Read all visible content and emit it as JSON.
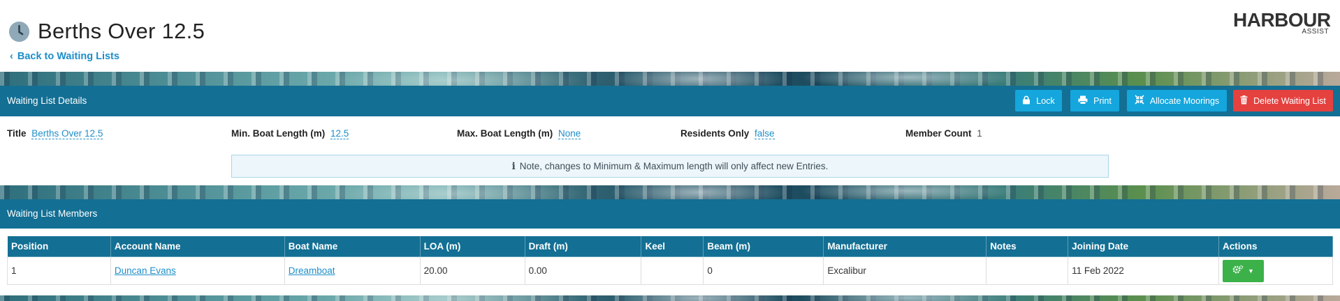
{
  "header": {
    "title": "Berths Over 12.5",
    "back_label": "Back to Waiting Lists",
    "logo_main": "HARBOUR",
    "logo_sub": "ASSIST"
  },
  "details_bar": {
    "title": "Waiting List Details",
    "buttons": {
      "lock": "Lock",
      "print": "Print",
      "allocate": "Allocate Moorings",
      "delete": "Delete Waiting List"
    }
  },
  "details": {
    "title_label": "Title",
    "title_value": "Berths Over 12.5",
    "min_label": "Min. Boat Length (m)",
    "min_value": "12.5",
    "max_label": "Max. Boat Length (m)",
    "max_value": "None",
    "residents_label": "Residents Only",
    "residents_value": "false",
    "count_label": "Member Count",
    "count_value": "1",
    "note": "Note, changes to Minimum & Maximum length will only affect new Entries."
  },
  "members_bar": {
    "title": "Waiting List Members"
  },
  "table": {
    "columns": [
      "Position",
      "Account Name",
      "Boat Name",
      "LOA (m)",
      "Draft (m)",
      "Keel",
      "Beam (m)",
      "Manufacturer",
      "Notes",
      "Joining Date",
      "Actions"
    ],
    "rows": [
      {
        "position": "1",
        "account": "Duncan Evans",
        "boat": "Dreamboat",
        "loa": "20.00",
        "draft": "0.00",
        "keel": "",
        "beam": "0",
        "manufacturer": "Excalibur",
        "notes": "",
        "joining": "11 Feb 2022"
      }
    ]
  },
  "colors": {
    "bar": "#136f94",
    "button_blue": "#14a6dd",
    "button_red": "#e5413f",
    "action_green": "#3cb14a",
    "link": "#1d8ec9"
  }
}
